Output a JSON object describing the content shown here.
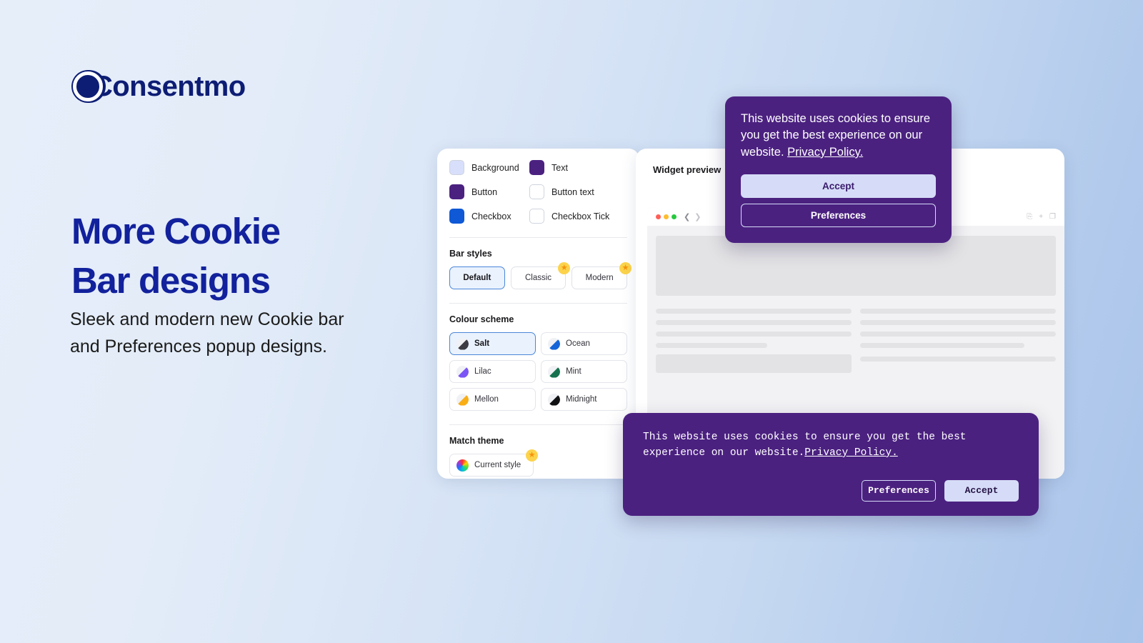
{
  "brand": {
    "name": "Consentmo",
    "logo_icon": "consentmo-c-logo"
  },
  "hero": {
    "headline_line1": "More Cookie",
    "headline_line2": "Bar designs",
    "subcopy": "Sleek and modern new Cookie bar and Preferences popup designs."
  },
  "settings_panel": {
    "legend": [
      {
        "label": "Background",
        "color": "#d7dffb"
      },
      {
        "label": "Text",
        "color": "#4b2180"
      },
      {
        "label": "Button",
        "color": "#4b2180"
      },
      {
        "label": "Button text",
        "color": "#ffffff"
      },
      {
        "label": "Checkbox",
        "color": "#0f58d6"
      },
      {
        "label": "Checkbox Tick",
        "color": "#ffffff"
      }
    ],
    "bar_styles": {
      "title": "Bar styles",
      "options": [
        {
          "label": "Default",
          "selected": true,
          "premium": false
        },
        {
          "label": "Classic",
          "selected": false,
          "premium": true
        },
        {
          "label": "Modern",
          "selected": false,
          "premium": true
        }
      ]
    },
    "colour_scheme": {
      "title": "Colour scheme",
      "options": [
        {
          "label": "Salt",
          "color": "#3c3c42",
          "selected": true
        },
        {
          "label": "Ocean",
          "color": "#1565d8",
          "selected": false
        },
        {
          "label": "Lilac",
          "color": "#7b55f5",
          "selected": false
        },
        {
          "label": "Mint",
          "color": "#16724e",
          "selected": false
        },
        {
          "label": "Mellon",
          "color": "#f9ae16",
          "selected": false
        },
        {
          "label": "Midnight",
          "color": "#111114",
          "selected": false
        }
      ]
    },
    "match_theme": {
      "title": "Match theme",
      "options": [
        {
          "label": "Current style",
          "icon": "rainbow-swatch",
          "premium": true
        }
      ]
    }
  },
  "preview_panel": {
    "title": "Widget preview",
    "browser": {
      "traffic_lights": [
        "#ff5f57",
        "#febc2e",
        "#28c840"
      ],
      "back_icon": "chevron-left-icon",
      "forward_icon": "chevron-right-icon",
      "toolbar_icons": [
        "share-icon",
        "plus-icon",
        "tabs-icon"
      ]
    }
  },
  "cookie_popup": {
    "message_prefix": "This website uses cookies to ensure you get the best experience on our website. ",
    "policy_link": "Privacy Policy.",
    "accept_label": "Accept",
    "preferences_label": "Preferences",
    "background": "#4b2180",
    "accept_bg": "#d6dcf7"
  },
  "cookie_bar": {
    "message_prefix": "This website uses cookies to ensure you get the best experience on our website.",
    "policy_link": "Privacy Policy.",
    "preferences_label": "Preferences",
    "accept_label": "Accept",
    "background": "#4b2180",
    "accept_bg": "#d6dcf7"
  }
}
